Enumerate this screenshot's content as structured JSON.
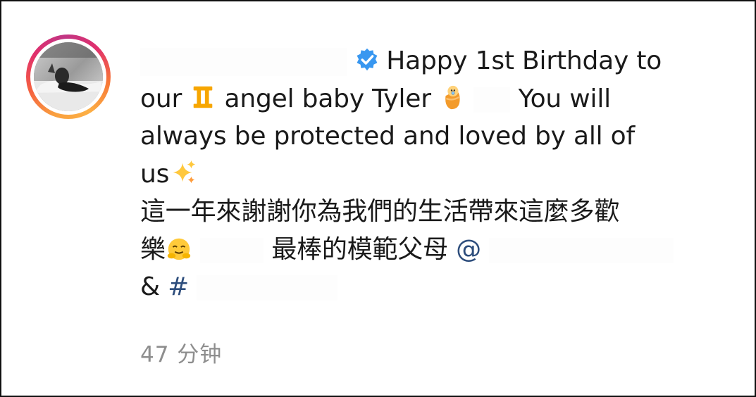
{
  "comment": {
    "line1_text": "Happy 1st Birthday to",
    "line2_part1": "our",
    "line2_part2": "angel baby Tyler",
    "line2_part3": "You will",
    "line3_text": "always be protected and loved by all of",
    "line4_text": "us",
    "line5_text": "這一年來謝謝你為我們的生活帶來這麼多歡",
    "line6_part1": "樂",
    "line6_part2": "最棒的模範父母",
    "mention_symbol": "@",
    "line7_part1": "&",
    "hashtag_symbol": "#"
  },
  "timestamp": "47 分钟",
  "icons": {
    "verified": "verified-badge-icon",
    "gemini": "gemini-zodiac-emoji",
    "baby": "swaddled-baby-emoji",
    "sparkles": "sparkles-emoji",
    "hug": "hugging-face-emoji"
  },
  "colors": {
    "text": "#1a1a1a",
    "link": "#2d4d7c",
    "timestamp": "#8e8e8e",
    "verified": "#3897f0"
  }
}
